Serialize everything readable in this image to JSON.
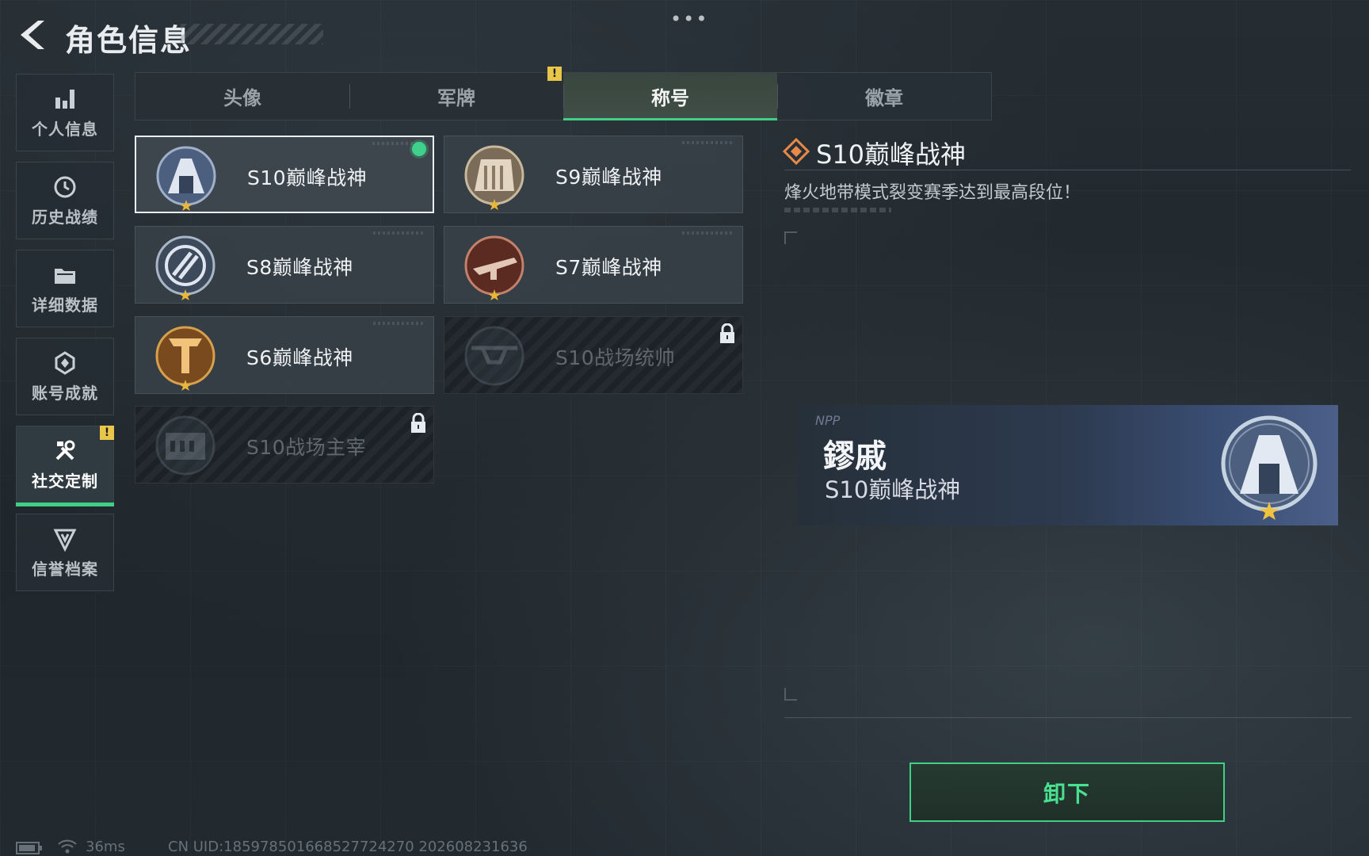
{
  "header": {
    "title": "角色信息",
    "menu": "•••"
  },
  "sidebar": {
    "items": [
      {
        "label": "个人信息",
        "icon": "bar-chart-icon"
      },
      {
        "label": "历史战绩",
        "icon": "clock-icon"
      },
      {
        "label": "详细数据",
        "icon": "folder-icon"
      },
      {
        "label": "账号成就",
        "icon": "medal-icon"
      },
      {
        "label": "社交定制",
        "icon": "tools-icon",
        "active": true,
        "badge": "!"
      },
      {
        "label": "信誉档案",
        "icon": "shield-icon"
      }
    ]
  },
  "tabs": [
    {
      "label": "头像"
    },
    {
      "label": "军牌",
      "badge": "!"
    },
    {
      "label": "称号",
      "active": true
    },
    {
      "label": "徽章"
    }
  ],
  "titles": [
    {
      "name": "S10巅峰战神",
      "selected": true,
      "equipped": true,
      "locked": false,
      "emblem": "tower-emblem"
    },
    {
      "name": "S9巅峰战神",
      "locked": false,
      "emblem": "dam-emblem"
    },
    {
      "name": "S8巅峰战神",
      "locked": false,
      "emblem": "ring-emblem"
    },
    {
      "name": "S7巅峰战神",
      "locked": false,
      "emblem": "rifle-emblem"
    },
    {
      "name": "S6巅峰战神",
      "locked": false,
      "emblem": "shield-t-emblem"
    },
    {
      "name": "S10战场统帅",
      "locked": true,
      "emblem": "drone-emblem"
    },
    {
      "name": "S10战场主宰",
      "locked": true,
      "emblem": "colosseum-emblem"
    }
  ],
  "detail": {
    "title": "S10巅峰战神",
    "description": "烽火地带模式裂变赛季达到最高段位！"
  },
  "preview": {
    "tag": "NPP",
    "player_name": "鏐戚",
    "title": "S10巅峰战神"
  },
  "actions": {
    "unequip_label": "卸下"
  },
  "status": {
    "ping": "36ms",
    "uid": "CN UID:18597850166852772427​0 202608231636"
  },
  "colors": {
    "accent": "#3fcf85",
    "warning": "#e8c64a",
    "background": "#232b31"
  }
}
